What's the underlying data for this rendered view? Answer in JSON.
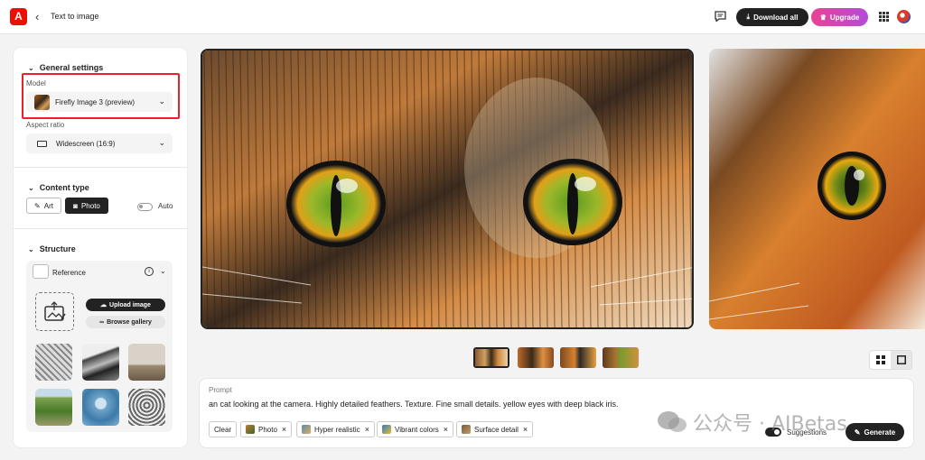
{
  "header": {
    "logo_text": "A",
    "back_icon": "chevron-left-icon",
    "title": "Text to image",
    "download_all": "Download all",
    "upgrade": "Upgrade"
  },
  "sidebar": {
    "general_settings": "General settings",
    "model_label": "Model",
    "model_value": "Firefly Image 3 (preview)",
    "aspect_label": "Aspect ratio",
    "aspect_value": "Widescreen (16:9)",
    "content_type": "Content type",
    "art": "Art",
    "photo": "Photo",
    "auto": "Auto",
    "structure": "Structure",
    "reference": "Reference",
    "upload_image": "Upload image",
    "browse_gallery": "Browse gallery"
  },
  "prompt": {
    "label": "Prompt",
    "text": "an cat looking at the camera. Highly detailed feathers. Texture. Fine small details. yellow eyes with deep black iris.",
    "clear": "Clear",
    "tags": [
      "Photo",
      "Hyper realistic",
      "Vibrant colors",
      "Surface detail"
    ],
    "suggestions": "Suggestions",
    "generate": "Generate"
  },
  "watermark": "公众号 · AIBetas",
  "colors": {
    "accent_dark": "#222222",
    "highlight_red": "#e8212a",
    "adobe_red": "#eb1000",
    "upgrade_gradient": [
      "#e84393",
      "#b44bd8"
    ]
  }
}
